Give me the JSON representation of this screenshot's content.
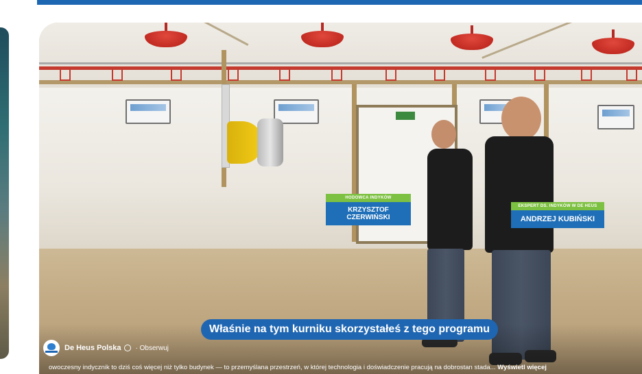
{
  "video": {
    "caption": "Właśnie na tym kurniku skorzystałeś z tego programu",
    "label_left": {
      "role": "HODOWCA INDYKÓW",
      "name": "KRZYSZTOF CZERWIŃSKI"
    },
    "label_right": {
      "role": "EKSPERT DS. INDYKÓW W DE HEUS",
      "name": "ANDRZEJ KUBIŃSKI"
    }
  },
  "channel": {
    "name": "De Heus Polska",
    "verified_icon": "verified-icon",
    "follow_label": "· Obserwuj"
  },
  "description": {
    "text": "owoczesny indycznik to dziś coś więcej niż tylko budynek — to przemyślana przestrzeń, w której technologia i doświadczenie pracują na dobrostan stada...",
    "more_label": "Wyświetl więcej"
  },
  "colors": {
    "accent_blue": "#1f66b2",
    "label_green": "#7dc142"
  }
}
